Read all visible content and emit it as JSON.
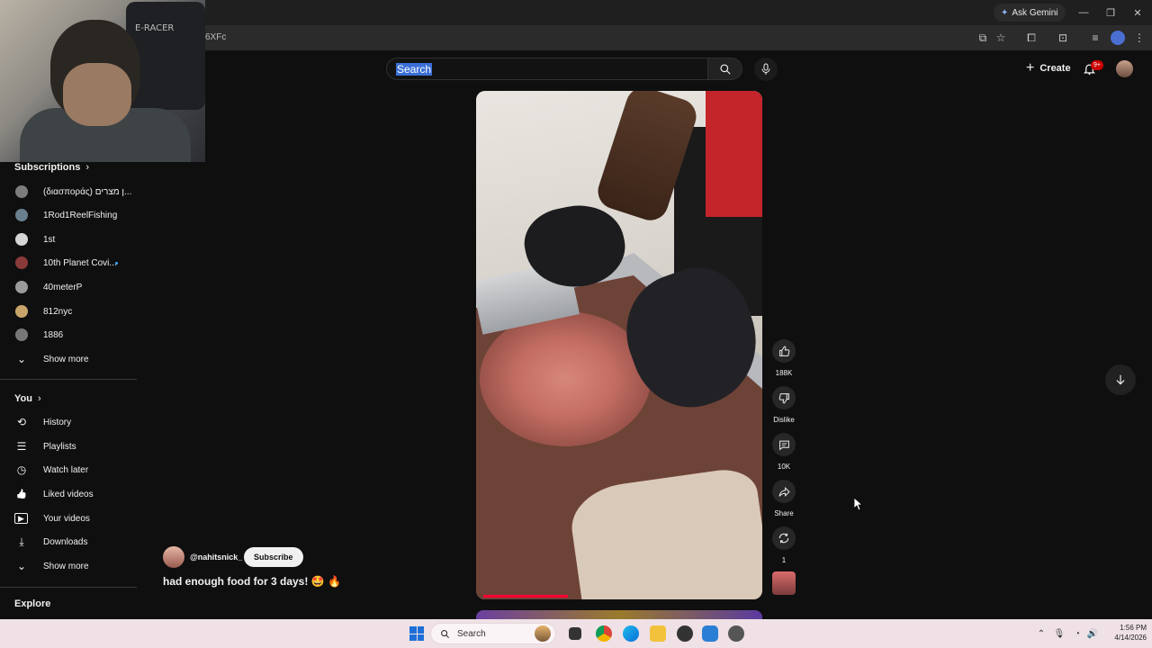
{
  "browser": {
    "ask_gemini": "Ask Gemini",
    "url_fragment": "6XFc",
    "window_controls": [
      "—",
      "❐",
      "✕"
    ]
  },
  "webcam": {
    "chair_text": "E-RACER"
  },
  "masthead": {
    "search_value": "Search",
    "create_label": "Create",
    "notifications_badge": "9+"
  },
  "sidebar": {
    "subscriptions_heading": "Subscriptions",
    "subscriptions": [
      {
        "label": "(διασποράς) ן מצרים...",
        "color": "#7c7c7c"
      },
      {
        "label": "1Rod1ReelFishing",
        "color": "#6a7f8d"
      },
      {
        "label": "1st",
        "color": "#d6d6d6"
      },
      {
        "label": "10th Planet Covi...",
        "color": "#8b3a3a",
        "new": true
      },
      {
        "label": "40meterP",
        "color": "#9a9a9a"
      },
      {
        "label": "812nyc",
        "color": "#c9a46a"
      },
      {
        "label": "1886",
        "color": "#777777"
      }
    ],
    "show_more_1": "Show more",
    "you_heading": "You",
    "you_items": [
      {
        "label": "History",
        "icon": "history-icon",
        "glyph": "⟲"
      },
      {
        "label": "Playlists",
        "icon": "playlists-icon",
        "glyph": "☰"
      },
      {
        "label": "Watch later",
        "icon": "clock-icon",
        "glyph": "◷"
      },
      {
        "label": "Liked videos",
        "icon": "thumbs-up-icon",
        "glyph": "👍"
      },
      {
        "label": "Your videos",
        "icon": "video-icon",
        "glyph": "▶"
      },
      {
        "label": "Downloads",
        "icon": "download-icon",
        "glyph": "⤓"
      }
    ],
    "show_more_2": "Show more",
    "explore_heading": "Explore"
  },
  "short": {
    "channel_handle": "@nahitsnick_",
    "subscribe_label": "Subscribe",
    "caption": "had enough food for 3 days! 🤩 🔥",
    "progress": 0.31
  },
  "actions": {
    "like_count": "188K",
    "dislike_label": "Dislike",
    "comments_count": "10K",
    "share_label": "Share",
    "remix_count": "1"
  },
  "taskbar": {
    "search_label": "Search",
    "time": "1:56 PM",
    "date": "4/14/2026"
  },
  "colors": {
    "background": "#0f0f0f",
    "accent_red": "#ff0033",
    "subscribe_bg": "#f1f1f1",
    "taskbar": "#efe1e6"
  }
}
